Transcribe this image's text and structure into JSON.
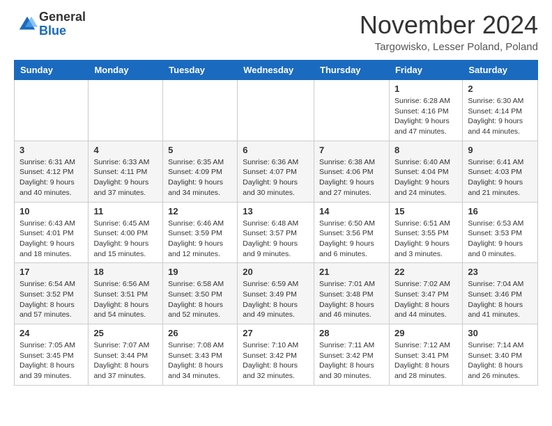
{
  "header": {
    "logo_general": "General",
    "logo_blue": "Blue",
    "month_title": "November 2024",
    "location": "Targowisko, Lesser Poland, Poland"
  },
  "calendar": {
    "headers": [
      "Sunday",
      "Monday",
      "Tuesday",
      "Wednesday",
      "Thursday",
      "Friday",
      "Saturday"
    ],
    "rows": [
      [
        {
          "day": "",
          "info": ""
        },
        {
          "day": "",
          "info": ""
        },
        {
          "day": "",
          "info": ""
        },
        {
          "day": "",
          "info": ""
        },
        {
          "day": "",
          "info": ""
        },
        {
          "day": "1",
          "info": "Sunrise: 6:28 AM\nSunset: 4:16 PM\nDaylight: 9 hours and 47 minutes."
        },
        {
          "day": "2",
          "info": "Sunrise: 6:30 AM\nSunset: 4:14 PM\nDaylight: 9 hours and 44 minutes."
        }
      ],
      [
        {
          "day": "3",
          "info": "Sunrise: 6:31 AM\nSunset: 4:12 PM\nDaylight: 9 hours and 40 minutes."
        },
        {
          "day": "4",
          "info": "Sunrise: 6:33 AM\nSunset: 4:11 PM\nDaylight: 9 hours and 37 minutes."
        },
        {
          "day": "5",
          "info": "Sunrise: 6:35 AM\nSunset: 4:09 PM\nDaylight: 9 hours and 34 minutes."
        },
        {
          "day": "6",
          "info": "Sunrise: 6:36 AM\nSunset: 4:07 PM\nDaylight: 9 hours and 30 minutes."
        },
        {
          "day": "7",
          "info": "Sunrise: 6:38 AM\nSunset: 4:06 PM\nDaylight: 9 hours and 27 minutes."
        },
        {
          "day": "8",
          "info": "Sunrise: 6:40 AM\nSunset: 4:04 PM\nDaylight: 9 hours and 24 minutes."
        },
        {
          "day": "9",
          "info": "Sunrise: 6:41 AM\nSunset: 4:03 PM\nDaylight: 9 hours and 21 minutes."
        }
      ],
      [
        {
          "day": "10",
          "info": "Sunrise: 6:43 AM\nSunset: 4:01 PM\nDaylight: 9 hours and 18 minutes."
        },
        {
          "day": "11",
          "info": "Sunrise: 6:45 AM\nSunset: 4:00 PM\nDaylight: 9 hours and 15 minutes."
        },
        {
          "day": "12",
          "info": "Sunrise: 6:46 AM\nSunset: 3:59 PM\nDaylight: 9 hours and 12 minutes."
        },
        {
          "day": "13",
          "info": "Sunrise: 6:48 AM\nSunset: 3:57 PM\nDaylight: 9 hours and 9 minutes."
        },
        {
          "day": "14",
          "info": "Sunrise: 6:50 AM\nSunset: 3:56 PM\nDaylight: 9 hours and 6 minutes."
        },
        {
          "day": "15",
          "info": "Sunrise: 6:51 AM\nSunset: 3:55 PM\nDaylight: 9 hours and 3 minutes."
        },
        {
          "day": "16",
          "info": "Sunrise: 6:53 AM\nSunset: 3:53 PM\nDaylight: 9 hours and 0 minutes."
        }
      ],
      [
        {
          "day": "17",
          "info": "Sunrise: 6:54 AM\nSunset: 3:52 PM\nDaylight: 8 hours and 57 minutes."
        },
        {
          "day": "18",
          "info": "Sunrise: 6:56 AM\nSunset: 3:51 PM\nDaylight: 8 hours and 54 minutes."
        },
        {
          "day": "19",
          "info": "Sunrise: 6:58 AM\nSunset: 3:50 PM\nDaylight: 8 hours and 52 minutes."
        },
        {
          "day": "20",
          "info": "Sunrise: 6:59 AM\nSunset: 3:49 PM\nDaylight: 8 hours and 49 minutes."
        },
        {
          "day": "21",
          "info": "Sunrise: 7:01 AM\nSunset: 3:48 PM\nDaylight: 8 hours and 46 minutes."
        },
        {
          "day": "22",
          "info": "Sunrise: 7:02 AM\nSunset: 3:47 PM\nDaylight: 8 hours and 44 minutes."
        },
        {
          "day": "23",
          "info": "Sunrise: 7:04 AM\nSunset: 3:46 PM\nDaylight: 8 hours and 41 minutes."
        }
      ],
      [
        {
          "day": "24",
          "info": "Sunrise: 7:05 AM\nSunset: 3:45 PM\nDaylight: 8 hours and 39 minutes."
        },
        {
          "day": "25",
          "info": "Sunrise: 7:07 AM\nSunset: 3:44 PM\nDaylight: 8 hours and 37 minutes."
        },
        {
          "day": "26",
          "info": "Sunrise: 7:08 AM\nSunset: 3:43 PM\nDaylight: 8 hours and 34 minutes."
        },
        {
          "day": "27",
          "info": "Sunrise: 7:10 AM\nSunset: 3:42 PM\nDaylight: 8 hours and 32 minutes."
        },
        {
          "day": "28",
          "info": "Sunrise: 7:11 AM\nSunset: 3:42 PM\nDaylight: 8 hours and 30 minutes."
        },
        {
          "day": "29",
          "info": "Sunrise: 7:12 AM\nSunset: 3:41 PM\nDaylight: 8 hours and 28 minutes."
        },
        {
          "day": "30",
          "info": "Sunrise: 7:14 AM\nSunset: 3:40 PM\nDaylight: 8 hours and 26 minutes."
        }
      ]
    ]
  }
}
